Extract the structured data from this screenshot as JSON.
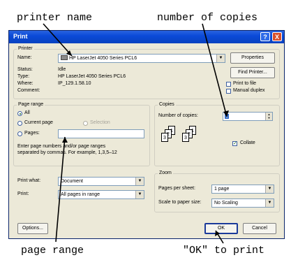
{
  "annotations": {
    "printer_name": "printer name",
    "number_of_copies": "number of copies",
    "page_range": "page range",
    "ok_to_print": "\"OK\" to print"
  },
  "dialog": {
    "title": "Print",
    "help_btn": "?",
    "close_btn": "X",
    "printer": {
      "group_label": "Printer",
      "name_label": "Name:",
      "name_value": "HP LaserJet 4050 Series PCL6",
      "properties_btn": "Properties",
      "status_label": "Status:",
      "status_value": "Idle",
      "type_label": "Type:",
      "type_value": "HP LaserJet 4050 Series PCL6",
      "where_label": "Where:",
      "where_value": "IP_129.1.58.10",
      "comment_label": "Comment:",
      "find_printer_btn": "Find Printer...",
      "print_to_file": "Print to file",
      "manual_duplex": "Manual duplex"
    },
    "page_range": {
      "group_label": "Page range",
      "all": "All",
      "current_page": "Current page",
      "selection": "Selection",
      "pages": "Pages:",
      "help_text_1": "Enter page numbers and/or page ranges",
      "help_text_2": "separated by commas.  For example, 1,3,5–12"
    },
    "copies": {
      "group_label": "Copies",
      "number_label": "Number of copies:",
      "number_value": "1",
      "collate": "Collate"
    },
    "print_what": {
      "label": "Print what:",
      "value": "Document"
    },
    "print_sel": {
      "label": "Print:",
      "value": "All pages in range"
    },
    "zoom": {
      "group_label": "Zoom",
      "pages_per_sheet_label": "Pages per sheet:",
      "pages_per_sheet_value": "1 page",
      "scale_label": "Scale to paper size:",
      "scale_value": "No Scaling"
    },
    "options_btn": "Options...",
    "ok_btn": "OK",
    "cancel_btn": "Cancel"
  }
}
